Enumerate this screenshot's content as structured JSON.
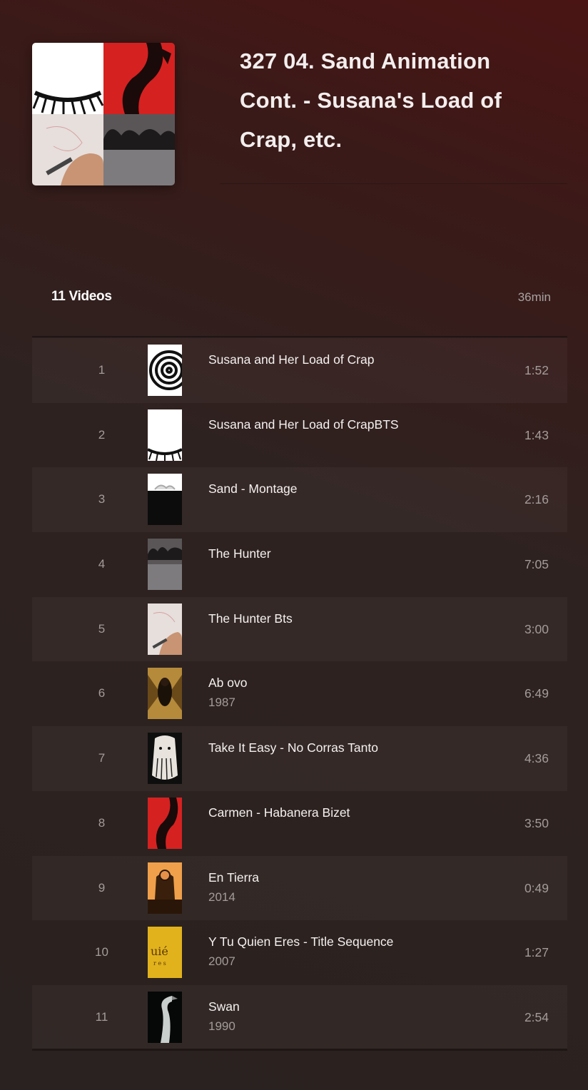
{
  "playlist": {
    "title": "327 04. Sand Animation Cont. - Susana's Load of Crap, etc.",
    "video_count": "11 Videos",
    "total_duration": "36min"
  },
  "tracks": [
    {
      "index": "1",
      "title": "Susana and Her Load of Crap",
      "year": "",
      "duration": "1:52",
      "thumb": "spiral"
    },
    {
      "index": "2",
      "title": "Susana and Her Load of CrapBTS",
      "year": "",
      "duration": "1:43",
      "thumb": "eyelash"
    },
    {
      "index": "3",
      "title": "Sand - Montage",
      "year": "",
      "duration": "2:16",
      "thumb": "sand"
    },
    {
      "index": "4",
      "title": "The Hunter",
      "year": "",
      "duration": "7:05",
      "thumb": "hunter"
    },
    {
      "index": "5",
      "title": "The Hunter Bts",
      "year": "",
      "duration": "3:00",
      "thumb": "hand-drawing"
    },
    {
      "index": "6",
      "title": "Ab ovo",
      "year": "1987",
      "duration": "6:49",
      "thumb": "winged-figure"
    },
    {
      "index": "7",
      "title": "Take It Easy - No Corras Tanto",
      "year": "",
      "duration": "4:36",
      "thumb": "bearded-face"
    },
    {
      "index": "8",
      "title": "Carmen - Habanera Bizet",
      "year": "",
      "duration": "3:50",
      "thumb": "red-dancer"
    },
    {
      "index": "9",
      "title": "En Tierra",
      "year": "2014",
      "duration": "0:49",
      "thumb": "orange-figure"
    },
    {
      "index": "10",
      "title": "Y Tu Quien Eres - Title Sequence",
      "year": "2007",
      "duration": "1:27",
      "thumb": "yellow-text"
    },
    {
      "index": "11",
      "title": "Swan",
      "year": "1990",
      "duration": "2:54",
      "thumb": "swan"
    }
  ]
}
